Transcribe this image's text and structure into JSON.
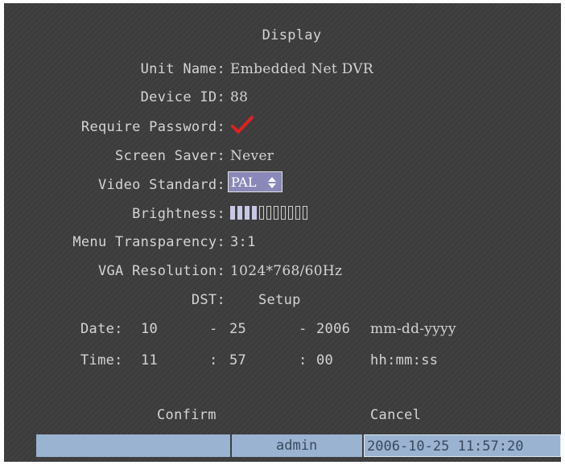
{
  "title": "Display",
  "fields": {
    "unit_name": {
      "label": "Unit Name:",
      "value": "Embedded Net DVR"
    },
    "device_id": {
      "label": "Device ID:",
      "value": "88"
    },
    "require_password": {
      "label": "Require Password:",
      "checked": true
    },
    "screen_saver": {
      "label": "Screen Saver:",
      "value": "Never"
    },
    "video_standard": {
      "label": "Video Standard:",
      "value": "PAL"
    },
    "brightness": {
      "label": "Brightness:",
      "filled": 4,
      "total": 11
    },
    "menu_transparency": {
      "label": "Menu Transparency:",
      "value": "3:1"
    },
    "vga_resolution": {
      "label": "VGA Resolution:",
      "value": "1024*768/60Hz"
    }
  },
  "dst": {
    "label": "DST:",
    "setup": "Setup"
  },
  "date": {
    "label": "Date:",
    "month": "10",
    "sep1": "-",
    "day": "25",
    "sep2": "-",
    "year": "2006",
    "format": "mm-dd-yyyy"
  },
  "time": {
    "label": "Time:",
    "hour": "11",
    "sep1": ":",
    "minute": "57",
    "sep2": ":",
    "second": "00",
    "format": "hh:mm:ss"
  },
  "buttons": {
    "confirm": "Confirm",
    "cancel": "Cancel"
  },
  "status": {
    "user": "admin",
    "datetime": "2006-10-25 11:57:20"
  },
  "colors": {
    "background": "#3d3d3d",
    "text": "#d4d4d4",
    "check": "#e02020",
    "highlight": "#8a88b8",
    "status_bar": "#9ab3d1"
  }
}
